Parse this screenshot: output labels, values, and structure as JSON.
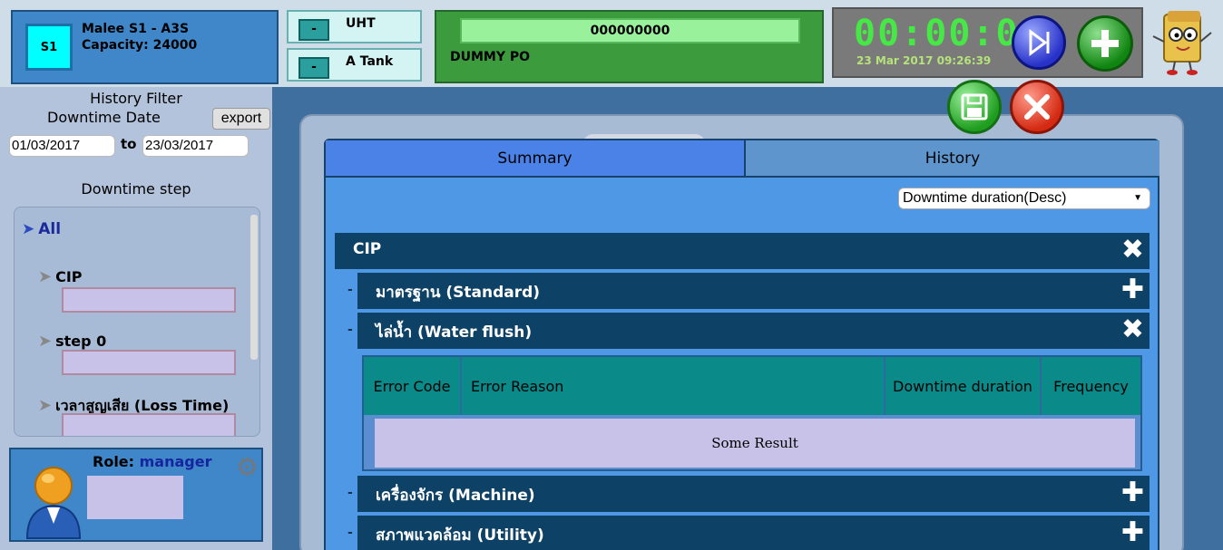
{
  "header": {
    "line_badge": "S1",
    "machine_name": "Malee S1 - A3S",
    "capacity": "Capacity: 24000",
    "product_1": "UHT",
    "product_2": "A Tank",
    "minus_label": "-",
    "po_number": "000000000",
    "po_label": "DUMMY PO",
    "timer": "00:00:08",
    "datetime": "23 Mar 2017 09:26:39"
  },
  "sidebar": {
    "history_filter_title": "History Filter",
    "downtime_date_title": "Downtime Date",
    "export_label": "export",
    "date_from": "01/03/2017",
    "date_to_label": "to",
    "date_to": "23/03/2017",
    "downtime_step_title": "Downtime step",
    "steps": [
      {
        "label": "All"
      },
      {
        "label": "CIP"
      },
      {
        "label": "step 0"
      },
      {
        "label": "เวลาสูญเสีย (Loss Time)"
      }
    ],
    "role_label": "Role:",
    "role_value": "manager"
  },
  "main": {
    "tabs": [
      {
        "label": "Summary",
        "active": true
      },
      {
        "label": "History",
        "active": false
      }
    ],
    "sort_value": "Downtime duration(Desc)",
    "group_title": "CIP",
    "subgroups": [
      {
        "label": "มาตรฐาน (Standard)",
        "expanded": false
      },
      {
        "label": "ไล่น้ำ (Water flush)",
        "expanded": true
      },
      {
        "label": "เครื่องจักร (Machine)",
        "expanded": false
      },
      {
        "label": "สภาพแวดล้อม (Utility)",
        "expanded": false
      }
    ],
    "dash": "-",
    "table": {
      "col_error_code": "Error Code",
      "col_error_reason": "Error Reason",
      "col_downtime": "Downtime duration",
      "col_frequency": "Frequency",
      "result_text": "Some Result"
    }
  },
  "colors": {
    "accent_blue": "#3f87c8",
    "dark_bar": "#0d4166",
    "teal_header": "#0b8a8a",
    "timer_green": "#46e846",
    "lavender": "#c9c2e8"
  }
}
